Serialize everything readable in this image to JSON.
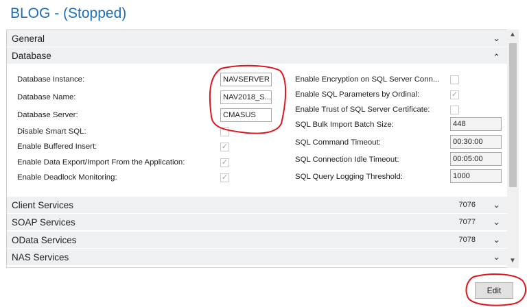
{
  "window": {
    "title": "BLOG - (Stopped)"
  },
  "sections": {
    "general": {
      "label": "General"
    },
    "database": {
      "label": "Database"
    },
    "client": {
      "label": "Client Services",
      "value": "7076"
    },
    "soap": {
      "label": "SOAP Services",
      "value": "7077"
    },
    "odata": {
      "label": "OData Services",
      "value": "7078"
    },
    "nas": {
      "label": "NAS Services"
    }
  },
  "database": {
    "instance": {
      "label": "Database Instance:",
      "value": "NAVSERVER"
    },
    "name": {
      "label": "Database Name:",
      "value": "NAV2018_S..."
    },
    "server": {
      "label": "Database Server:",
      "value": "CMASUS"
    },
    "smart_sql": {
      "label": "Disable Smart SQL:",
      "checked": false
    },
    "buffered_insert": {
      "label": "Enable Buffered Insert:",
      "checked": true
    },
    "data_export": {
      "label": "Enable Data Export/Import From the Application:",
      "checked": true
    },
    "deadlock": {
      "label": "Enable Deadlock Monitoring:",
      "checked": true
    },
    "encryption": {
      "label": "Enable Encryption on SQL Server Conn...",
      "checked": false
    },
    "sql_params": {
      "label": "Enable SQL Parameters by Ordinal:",
      "checked": true
    },
    "trust_cert": {
      "label": "Enable Trust of SQL Server Certificate:",
      "checked": false
    },
    "bulk_import": {
      "label": "SQL Bulk Import Batch Size:",
      "value": "448"
    },
    "cmd_timeout": {
      "label": "SQL Command Timeout:",
      "value": "00:30:00"
    },
    "idle_timeout": {
      "label": "SQL Connection Idle Timeout:",
      "value": "00:05:00"
    },
    "query_logging": {
      "label": "SQL Query Logging Threshold:",
      "value": "1000"
    }
  },
  "actions": {
    "edit": "Edit"
  },
  "icons": {
    "collapse": "chevron-up-icon",
    "expand": "chevron-down-icon",
    "check": "checkmark-icon"
  },
  "colors": {
    "title": "#1f6fb8",
    "annotation": "#e0141c",
    "section_bg": "#eef0f2"
  }
}
